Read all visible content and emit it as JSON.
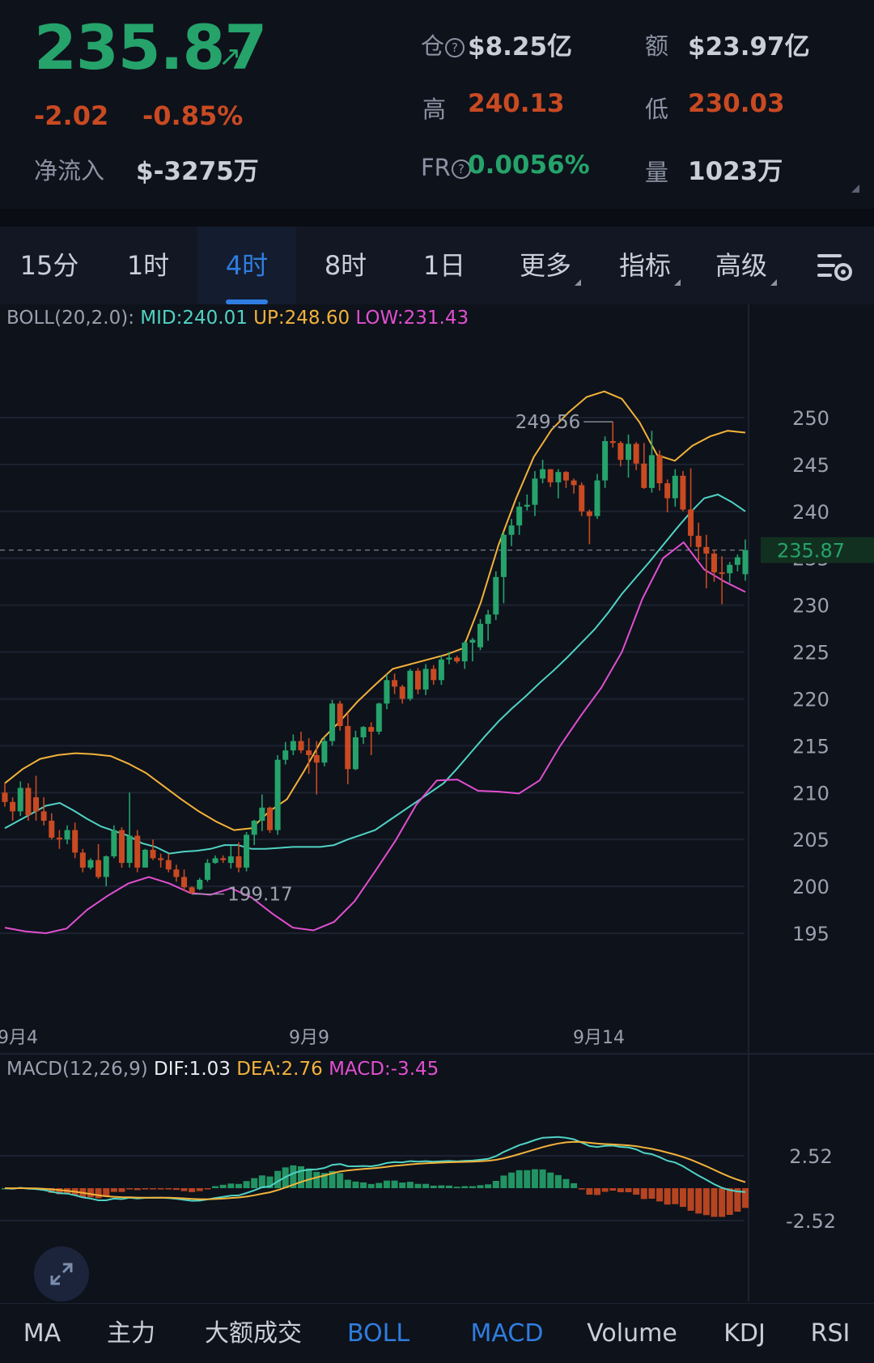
{
  "header": {
    "price": "235.87",
    "change": "-2.02",
    "change_pct": "-0.85%",
    "netflow_label": "净流入",
    "netflow_value": "$-3275万",
    "oi_label": "仓",
    "oi_value": "$8.25亿",
    "amount_label": "额",
    "amount_value": "$23.97亿",
    "high_label": "高",
    "high_value": "240.13",
    "low_label": "低",
    "low_value": "230.03",
    "fr_label": "FR",
    "fr_value": "0.0056%",
    "vol_label": "量",
    "vol_value": "1023万"
  },
  "tabs": [
    {
      "label": "15分"
    },
    {
      "label": "1时"
    },
    {
      "label": "4时"
    },
    {
      "label": "8时"
    },
    {
      "label": "1日"
    },
    {
      "label": "更多"
    },
    {
      "label": "指标"
    },
    {
      "label": "高级"
    }
  ],
  "bottom_tabs": [
    {
      "label": "MA"
    },
    {
      "label": "主力"
    },
    {
      "label": "大额成交"
    },
    {
      "label": "BOLL"
    },
    {
      "label": "MACD"
    },
    {
      "label": "Volume"
    },
    {
      "label": "KDJ"
    },
    {
      "label": "RSI"
    }
  ],
  "colors": {
    "up": "#25a36b",
    "down": "#c94a22",
    "mid": "#4fd3c4",
    "upper": "#f2b23a",
    "lower": "#e14fd0",
    "accent": "#2f7de0",
    "dif": "#4fd3c4",
    "dea": "#f2b23a",
    "macd": "#e14fd0"
  },
  "chart_data": [
    {
      "type": "candlestick",
      "indicator": {
        "name": "BOLL(20,2.0):",
        "mid": "MID:240.01",
        "up": "UP:248.60",
        "low": "LOW:231.43"
      },
      "y_ticks": [
        "250",
        "245",
        "240",
        "235",
        "230",
        "225",
        "220",
        "215",
        "210",
        "205",
        "200",
        "195"
      ],
      "x_ticks": [
        "9月4",
        "9月9",
        "9月14"
      ],
      "ylim": [
        194,
        256
      ],
      "last_price_label": "235.87",
      "last_price": 235.87,
      "high_marker": {
        "label": "249.56",
        "value": 249.56
      },
      "low_marker": {
        "label": "199.17",
        "value": 199.17
      },
      "candles": [
        [
          210,
          211,
          208.5,
          209
        ],
        [
          209,
          209.5,
          207,
          208
        ],
        [
          208,
          211.2,
          207.5,
          210.5
        ],
        [
          210.5,
          211,
          207,
          207.6
        ],
        [
          209.5,
          211.8,
          207,
          208
        ],
        [
          208,
          209.5,
          206.5,
          207
        ],
        [
          207,
          207.8,
          205,
          205.2
        ],
        [
          205.2,
          206,
          204,
          205
        ],
        [
          205,
          206.5,
          204.5,
          206
        ],
        [
          206,
          206.8,
          203,
          203.6
        ],
        [
          203.6,
          204,
          201.5,
          202
        ],
        [
          202,
          203,
          201.8,
          202.8
        ],
        [
          202.8,
          204.5,
          200.8,
          201
        ],
        [
          201,
          203.3,
          200,
          203.2
        ],
        [
          203.2,
          206.5,
          203,
          206
        ],
        [
          206,
          206.3,
          202,
          202.5
        ],
        [
          202.5,
          210,
          202,
          205.4
        ],
        [
          205.4,
          206,
          201.5,
          202
        ],
        [
          202,
          204,
          202,
          203.9
        ],
        [
          203.9,
          205,
          202.8,
          203
        ],
        [
          203,
          203.5,
          202,
          202.8
        ],
        [
          202.8,
          203.5,
          201.5,
          201.8
        ],
        [
          201.8,
          202.3,
          200.5,
          201
        ],
        [
          201,
          201.8,
          199.5,
          199.9
        ],
        [
          199.9,
          200,
          199.17,
          199.3
        ],
        [
          199.7,
          200.9,
          199.6,
          200.7
        ],
        [
          200.7,
          202.9,
          200.5,
          202.5
        ],
        [
          202.5,
          203.3,
          202.4,
          203
        ],
        [
          203,
          203.3,
          202.5,
          202.8
        ],
        [
          202.5,
          204.3,
          201.9,
          203.2
        ],
        [
          203.2,
          204.7,
          201.5,
          202
        ],
        [
          202,
          205.8,
          201.6,
          205.5
        ],
        [
          205.5,
          207.1,
          204.4,
          207
        ],
        [
          207,
          209.8,
          205.9,
          208.4
        ],
        [
          208.4,
          208.5,
          205.7,
          206
        ],
        [
          206,
          214,
          205.5,
          213.5
        ],
        [
          213.5,
          215.4,
          213,
          214.5
        ],
        [
          214.5,
          216.2,
          214,
          215.5
        ],
        [
          215.5,
          216.5,
          214.2,
          214.5
        ],
        [
          214.5,
          215.8,
          212,
          214
        ],
        [
          214,
          215.5,
          209.8,
          213.2
        ],
        [
          213.2,
          215.9,
          212.8,
          215.5
        ],
        [
          215.5,
          219.9,
          215,
          219.5
        ],
        [
          219.5,
          219.8,
          216.6,
          217.1
        ],
        [
          217.1,
          218.5,
          210.9,
          212.5
        ],
        [
          212.5,
          216.6,
          212.4,
          215.9
        ],
        [
          215.9,
          217.1,
          215.2,
          217
        ],
        [
          217,
          217.5,
          214,
          216.5
        ],
        [
          216.5,
          219.6,
          216.2,
          219.5
        ],
        [
          219.5,
          222.6,
          218.9,
          222
        ],
        [
          222,
          222.7,
          220.5,
          221.3
        ],
        [
          221.3,
          221.5,
          219.5,
          220
        ],
        [
          220,
          223.2,
          219.8,
          223
        ],
        [
          223,
          223.3,
          220.5,
          221
        ],
        [
          221,
          223.7,
          220.4,
          223.2
        ],
        [
          223.2,
          223.6,
          221.5,
          222
        ],
        [
          222,
          224.6,
          221.5,
          224.2
        ],
        [
          224.2,
          225,
          223.7,
          224.4
        ],
        [
          224.4,
          224.6,
          223.8,
          224
        ],
        [
          224,
          226.2,
          223.2,
          226
        ],
        [
          226,
          226.5,
          224,
          226.3
        ],
        [
          225.5,
          228.5,
          225.2,
          228
        ],
        [
          228,
          229.5,
          226.2,
          229
        ],
        [
          229,
          233.6,
          228.4,
          233
        ],
        [
          233,
          237.8,
          230.2,
          237.5
        ],
        [
          237.5,
          239.2,
          236.3,
          238.5
        ],
        [
          238.5,
          241,
          237.5,
          240.5
        ],
        [
          240.5,
          241.8,
          240.1,
          240.7
        ],
        [
          240.7,
          244.3,
          239.5,
          243.5
        ],
        [
          243.5,
          245.5,
          243,
          244.5
        ],
        [
          244.5,
          244.5,
          242.6,
          243.1
        ],
        [
          243.1,
          244.5,
          241.4,
          244.2
        ],
        [
          244.2,
          244.3,
          242.5,
          243.3
        ],
        [
          243.3,
          243.5,
          241.9,
          242.8
        ],
        [
          242.8,
          243.1,
          239.5,
          240
        ],
        [
          240,
          240.2,
          236.5,
          239.5
        ],
        [
          239.5,
          244,
          239.2,
          243.3
        ],
        [
          243.3,
          248,
          242.5,
          247.5
        ],
        [
          247.5,
          249.56,
          246.8,
          247.3
        ],
        [
          247.3,
          247.5,
          244.8,
          245.5
        ],
        [
          245.5,
          248.2,
          243.6,
          247.2
        ],
        [
          247.2,
          247.4,
          244.4,
          245.1
        ],
        [
          245.1,
          247.3,
          242.4,
          242.5
        ],
        [
          242.5,
          248.6,
          242,
          246
        ],
        [
          246,
          246.5,
          242.2,
          243
        ],
        [
          243,
          243.4,
          239.9,
          241.4
        ],
        [
          241.4,
          244.5,
          240.5,
          243.8
        ],
        [
          243.8,
          244.3,
          240,
          240.2
        ],
        [
          240.2,
          244.6,
          236.2,
          237.4
        ],
        [
          237.4,
          238.8,
          234.8,
          236.2
        ],
        [
          236.2,
          237.5,
          231.8,
          235.5
        ],
        [
          235.5,
          235.9,
          232.5,
          233.5
        ],
        [
          233.5,
          235.2,
          230.1,
          233.4
        ],
        [
          233.4,
          234.6,
          232.4,
          234.3
        ],
        [
          234.3,
          235.4,
          233.6,
          235.1
        ],
        [
          233.3,
          237,
          232.6,
          235.87
        ]
      ],
      "boll_mid": [
        206.2,
        207,
        207.8,
        208.6,
        208.9,
        208.1,
        207.2,
        206.4,
        205.9,
        205.4,
        204.6,
        204.2,
        203.5,
        203.7,
        203.8,
        204.0,
        204.4,
        204.4,
        204.0,
        204.0,
        204.1,
        204.2,
        204.2,
        204.2,
        204.4,
        205.0,
        205.5,
        206.0,
        207.0,
        208.0,
        209.0,
        210.0,
        211.0,
        212.6,
        214.3,
        216.0,
        217.6,
        219.0,
        220.3,
        221.7,
        223.0,
        224.4,
        225.9,
        227.4,
        229.2,
        231.2,
        232.9,
        234.6,
        236.4,
        238.2,
        239.9,
        241.4,
        241.8,
        241.0,
        240.0
      ],
      "boll_up": [
        211,
        212.5,
        213.6,
        214.0,
        214.2,
        214.1,
        213.9,
        213.1,
        212.1,
        210.7,
        209.3,
        208.0,
        206.9,
        206.0,
        206.2,
        208.0,
        209.3,
        212.4,
        215.7,
        217.6,
        219.7,
        221.5,
        223.2,
        223.7,
        224.2,
        224.7,
        225.4,
        230.3,
        236.4,
        241.4,
        245.8,
        248.7,
        250.6,
        252.2,
        252.8,
        252.0,
        249.5,
        246.0,
        245.4,
        247.0,
        248.0,
        248.6,
        248.4
      ],
      "boll_low": [
        195.6,
        195.2,
        195.0,
        195.5,
        197.5,
        199.0,
        200.3,
        201.0,
        200.3,
        199.3,
        199.1,
        199.8,
        198.8,
        197.1,
        195.6,
        195.3,
        196.2,
        198.4,
        201.6,
        204.9,
        208.7,
        211.3,
        211.4,
        210.2,
        210.1,
        209.9,
        211.3,
        215.0,
        218.2,
        221.2,
        225.0,
        230.7,
        235.0,
        236.7,
        233.8,
        232.5,
        231.4
      ],
      "macd_ticks": [
        "2.52",
        "-2.52"
      ]
    }
  ]
}
